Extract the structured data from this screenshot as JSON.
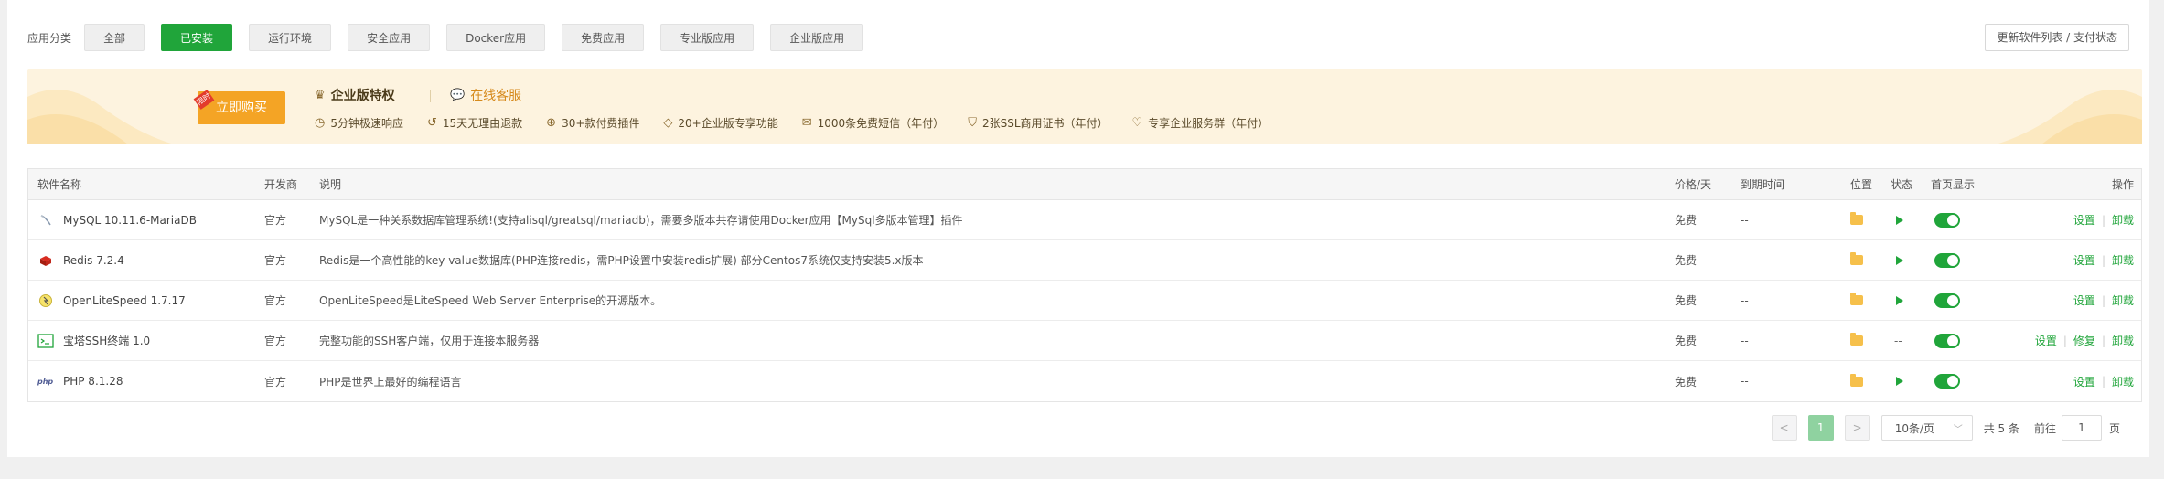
{
  "categories": {
    "label": "应用分类",
    "items": [
      {
        "label": "全部",
        "active": false
      },
      {
        "label": "已安装",
        "active": true
      },
      {
        "label": "运行环境",
        "active": false
      },
      {
        "label": "安全应用",
        "active": false
      },
      {
        "label": "Docker应用",
        "active": false
      },
      {
        "label": "免费应用",
        "active": false
      },
      {
        "label": "专业版应用",
        "active": false
      },
      {
        "label": "企业版应用",
        "active": false
      }
    ],
    "refresh_button": "更新软件列表 / 支付状态"
  },
  "banner": {
    "buy_button": "立即购买",
    "buy_tag": "限时",
    "title": "企业版特权",
    "service_link": "在线客服",
    "features": [
      {
        "icon": "clock-icon",
        "label": "5分钟极速响应"
      },
      {
        "icon": "refund-icon",
        "label": "15天无理由退款"
      },
      {
        "icon": "plugin-icon",
        "label": "30+款付费插件"
      },
      {
        "icon": "diamond-icon",
        "label": "20+企业版专享功能"
      },
      {
        "icon": "mail-icon",
        "label": "1000条免费短信（年付）"
      },
      {
        "icon": "ssl-icon",
        "label": "2张SSL商用证书（年付）"
      },
      {
        "icon": "heart-icon",
        "label": "专享企业服务群（年付）"
      }
    ],
    "accent_color": "#f4a425"
  },
  "table": {
    "headers": {
      "name": "软件名称",
      "developer": "开发商",
      "description": "说明",
      "price": "价格/天",
      "expire": "到期时间",
      "position": "位置",
      "status": "状态",
      "home": "首页显示",
      "operation": "操作"
    },
    "rows": [
      {
        "icon": "mysql-icon",
        "name": "MySQL 10.11.6-MariaDB",
        "developer": "官方",
        "description": "MySQL是一种关系数据库管理系统!(支持alisql/greatsql/mariadb)，需要多版本共存请使用Docker应用【MySql多版本管理】插件",
        "price": "免费",
        "expire": "--",
        "status": "running",
        "home": true,
        "ops": [
          "设置",
          "卸载"
        ]
      },
      {
        "icon": "redis-icon",
        "name": "Redis 7.2.4",
        "developer": "官方",
        "description": "Redis是一个高性能的key-value数据库(PHP连接redis，需PHP设置中安装redis扩展) 部分Centos7系统仅支持安装5.x版本",
        "price": "免费",
        "expire": "--",
        "status": "running",
        "home": true,
        "ops": [
          "设置",
          "卸载"
        ]
      },
      {
        "icon": "litespeed-icon",
        "name": "OpenLiteSpeed 1.7.17",
        "developer": "官方",
        "description": "OpenLiteSpeed是LiteSpeed Web Server Enterprise的开源版本。",
        "price": "免费",
        "expire": "--",
        "status": "running",
        "home": true,
        "ops": [
          "设置",
          "卸载"
        ]
      },
      {
        "icon": "terminal-icon",
        "name": "宝塔SSH终端 1.0",
        "developer": "官方",
        "description": "完整功能的SSH客户端，仅用于连接本服务器",
        "price": "免费",
        "expire": "--",
        "status_text": "--",
        "status": "none",
        "home": true,
        "ops": [
          "设置",
          "修复",
          "卸载"
        ]
      },
      {
        "icon": "php-icon",
        "name": "PHP 8.1.28",
        "developer": "官方",
        "description": "PHP是世界上最好的编程语言",
        "price": "免费",
        "expire": "--",
        "status": "running",
        "home": true,
        "ops": [
          "设置",
          "卸载"
        ]
      }
    ]
  },
  "pagination": {
    "prev": "<",
    "current": "1",
    "next": ">",
    "page_size": "10条/页",
    "total": "共 5 条",
    "goto_label": "前往",
    "goto_value": "1",
    "page_suffix": "页"
  },
  "colors": {
    "primary_green": "#20a53a",
    "folder_yellow": "#f6c04b"
  }
}
